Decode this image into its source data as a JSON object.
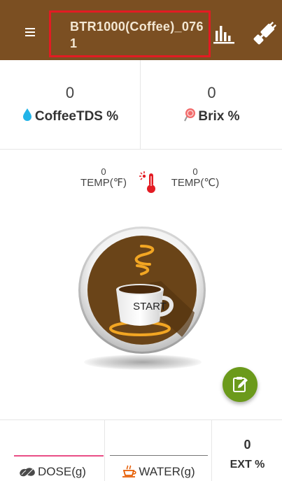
{
  "header": {
    "title": "BTR1000(Coffee)_0761",
    "menu_icon": "hamburger-menu-icon",
    "chart_icon": "bar-chart-icon",
    "plug_icon": "plug-connect-icon",
    "background_color": "#7b4f22",
    "highlight_border_color": "#e31b23"
  },
  "metrics": {
    "coffee_tds": {
      "value": "0",
      "label": "CoffeeTDS %",
      "icon": "water-drop-icon"
    },
    "brix": {
      "value": "0",
      "label": "Brix %",
      "icon": "lollipop-icon"
    }
  },
  "temperature": {
    "fahrenheit": {
      "value": "0",
      "label": "TEMP(℉)"
    },
    "celsius": {
      "value": "0",
      "label": "TEMP(℃)"
    },
    "icon": "thermometer-icon"
  },
  "start_button": {
    "label": "START",
    "icon": "coffee-cup-icon"
  },
  "fab": {
    "icon": "edit-note-icon",
    "color": "#6b9a1b"
  },
  "bottom": {
    "dose": {
      "label": "DOSE(g)",
      "value": "",
      "icon": "coffee-beans-icon",
      "underline_color": "#e94e86"
    },
    "water": {
      "label": "WATER(g)",
      "value": "",
      "icon": "cup-icon"
    },
    "ext": {
      "value": "0",
      "label": "EXT %"
    }
  }
}
